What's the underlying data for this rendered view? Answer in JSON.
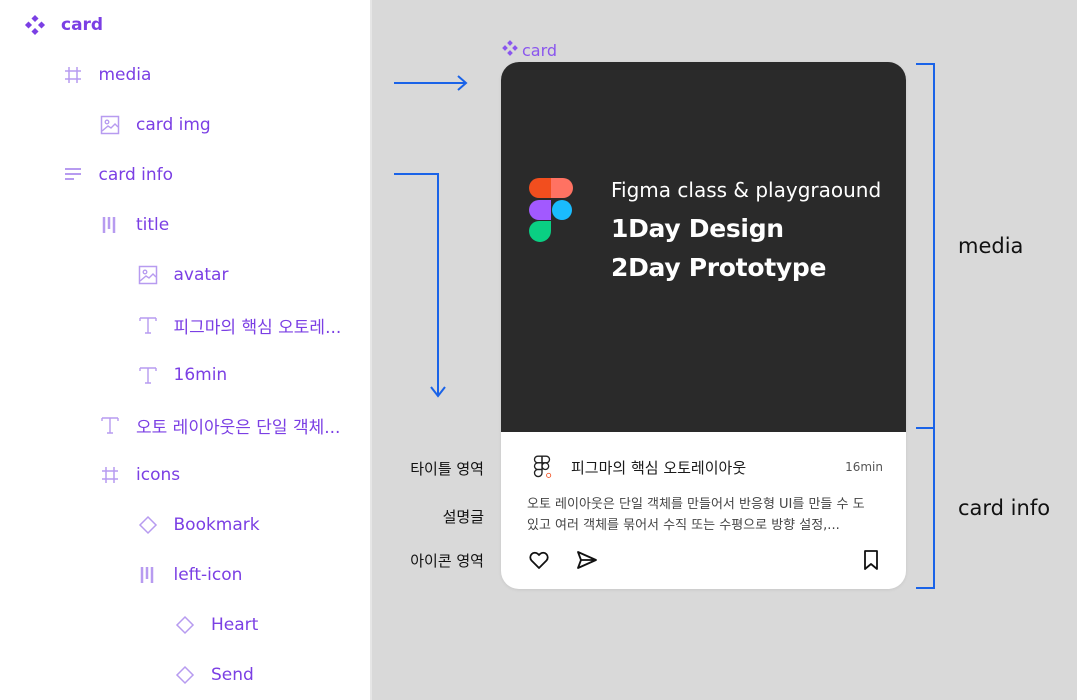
{
  "layers": [
    {
      "label": "card",
      "icon": "component-icon",
      "indent": 0
    },
    {
      "label": "media",
      "icon": "frame-icon",
      "indent": 1
    },
    {
      "label": "card img",
      "icon": "image-icon",
      "indent": 2
    },
    {
      "label": "card info",
      "icon": "vertical-autolayout-icon",
      "indent": 1
    },
    {
      "label": "title",
      "icon": "horizontal-autolayout-icon",
      "indent": 2
    },
    {
      "label": "avatar",
      "icon": "image-icon",
      "indent": 3
    },
    {
      "label": "피그마의 핵심 오토레...",
      "icon": "text-icon",
      "indent": 3
    },
    {
      "label": "16min",
      "icon": "text-icon",
      "indent": 3
    },
    {
      "label": "오토 레이아웃은 단일 객체...",
      "icon": "text-icon",
      "indent": 2
    },
    {
      "label": "icons",
      "icon": "frame-icon",
      "indent": 2
    },
    {
      "label": "Bookmark",
      "icon": "instance-icon",
      "indent": 3
    },
    {
      "label": "left-icon",
      "icon": "horizontal-autolayout-icon",
      "indent": 3
    },
    {
      "label": "Heart",
      "icon": "instance-icon",
      "indent": 4
    },
    {
      "label": "Send",
      "icon": "instance-icon",
      "indent": 4
    }
  ],
  "canvas": {
    "frame_label": "card",
    "media": {
      "subtitle": "Figma class & playgraound",
      "heading1": "1Day Design",
      "heading2": "2Day Prototype"
    },
    "info": {
      "title": "피그마의 핵심 오토레이아웃",
      "time": "16min",
      "description": "오토 레이아웃은 단일 객체를 만들어서 반응형 UI를 만들 수 도 있고 여러 객체를 묶어서 수직 또는 수평으로 방향 설정,..."
    },
    "annotations": {
      "title_area": "타이틀 영역",
      "description": "설명글",
      "icon_area": "아이콘 영역",
      "media": "media",
      "card_info": "card info"
    }
  },
  "colors": {
    "layer_text": "#7b3fe4",
    "annotation_line": "#1a63e8",
    "media_bg": "#2a2a2a",
    "canvas_bg": "#d9d9d9"
  }
}
